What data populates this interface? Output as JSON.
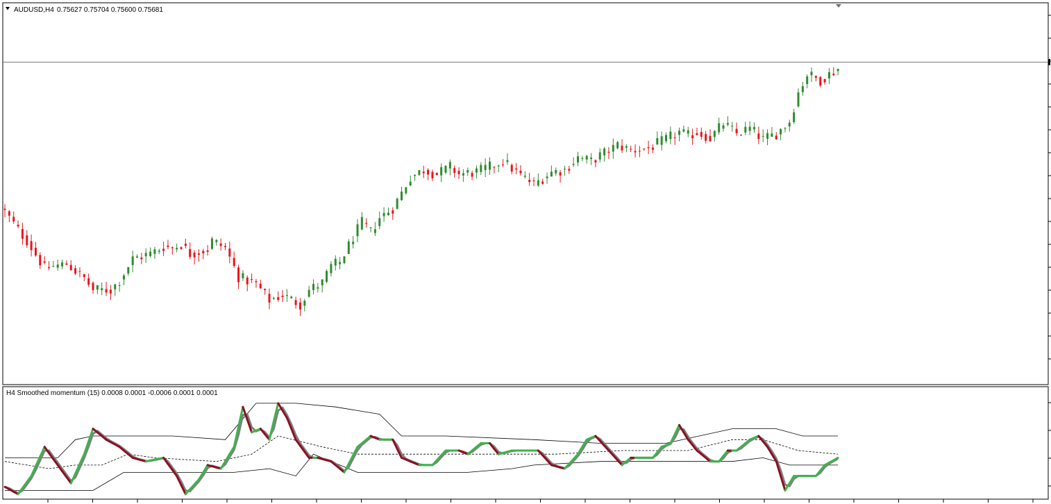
{
  "main_header": {
    "symbol_label": "AUDUSD,H4",
    "ohlc": "0.75627 0.75704 0.75600 0.75681"
  },
  "indicator_header": {
    "label": "H4 Smoothed momentum (15) 0.0008 0.0001 -0.0006 0.0001 0.0001"
  },
  "icons": {
    "header_menu": "triangle-down-icon",
    "shift_marker": "triangle-down-icon"
  },
  "colors": {
    "up_candle": "#2e8b2e",
    "down_candle": "#e8141a",
    "momentum_up": "#3cb44a",
    "momentum_down": "#8b1020",
    "momentum_raw": "#808080",
    "band": "#000000"
  },
  "chart_data": [
    {
      "type": "candlestick",
      "symbol": "AUDUSD",
      "timeframe": "H4",
      "last_price": 0.75681,
      "price_range": [
        0.7135,
        0.7655
      ],
      "count": 190,
      "close_path": [
        [
          0,
          0.737
        ],
        [
          3,
          0.7345
        ],
        [
          5,
          0.733
        ],
        [
          9,
          0.7292
        ],
        [
          14,
          0.7298
        ],
        [
          18,
          0.7278
        ],
        [
          20,
          0.7262
        ],
        [
          24,
          0.7262
        ],
        [
          26,
          0.7275
        ],
        [
          29,
          0.7305
        ],
        [
          33,
          0.7312
        ],
        [
          36,
          0.7322
        ],
        [
          38,
          0.732
        ],
        [
          40,
          0.7325
        ],
        [
          42,
          0.7312
        ],
        [
          46,
          0.7318
        ],
        [
          47,
          0.733
        ],
        [
          50,
          0.732
        ],
        [
          53,
          0.728
        ],
        [
          57,
          0.727
        ],
        [
          60,
          0.7248
        ],
        [
          63,
          0.7255
        ],
        [
          67,
          0.7242
        ],
        [
          69,
          0.7262
        ],
        [
          72,
          0.7272
        ],
        [
          74,
          0.7295
        ],
        [
          76,
          0.73
        ],
        [
          79,
          0.7335
        ],
        [
          81,
          0.7355
        ],
        [
          83,
          0.7342
        ],
        [
          85,
          0.7362
        ],
        [
          88,
          0.7375
        ],
        [
          92,
          0.7418
        ],
        [
          95,
          0.7428
        ],
        [
          98,
          0.7422
        ],
        [
          101,
          0.7432
        ],
        [
          103,
          0.7422
        ],
        [
          107,
          0.7425
        ],
        [
          110,
          0.7432
        ],
        [
          113,
          0.744
        ],
        [
          117,
          0.742
        ],
        [
          120,
          0.7408
        ],
        [
          124,
          0.7425
        ],
        [
          127,
          0.7428
        ],
        [
          130,
          0.7445
        ],
        [
          133,
          0.744
        ],
        [
          137,
          0.7455
        ],
        [
          139,
          0.7462
        ],
        [
          142,
          0.7455
        ],
        [
          146,
          0.7458
        ],
        [
          150,
          0.747
        ],
        [
          153,
          0.748
        ],
        [
          155,
          0.7475
        ],
        [
          157,
          0.748
        ],
        [
          160,
          0.7472
        ],
        [
          163,
          0.7492
        ],
        [
          166,
          0.7478
        ],
        [
          169,
          0.7485
        ],
        [
          172,
          0.747
        ],
        [
          175,
          0.7478
        ],
        [
          178,
          0.7495
        ],
        [
          180,
          0.7535
        ],
        [
          182,
          0.756
        ],
        [
          185,
          0.7552
        ],
        [
          189,
          0.7568
        ]
      ]
    },
    {
      "type": "line",
      "title": "H4 Smoothed momentum (15)",
      "values_shown": [
        0.0008,
        0.0001,
        -0.0006,
        0.0001,
        0.0001
      ],
      "value_range": [
        -0.0012,
        0.0018
      ],
      "series": [
        {
          "role": "momentum",
          "points": [
            [
              0,
              -0.0009
            ],
            [
              3,
              -0.0011
            ],
            [
              6,
              -0.0006
            ],
            [
              9,
              0.0002
            ],
            [
              12,
              -0.0003
            ],
            [
              15,
              -0.0008
            ],
            [
              18,
              0.0
            ],
            [
              20,
              0.0007
            ],
            [
              23,
              0.0004
            ],
            [
              26,
              0.0002
            ],
            [
              29,
              -0.0001
            ],
            [
              32,
              -0.0002
            ],
            [
              36,
              -0.0001
            ],
            [
              39,
              -0.0006
            ],
            [
              41,
              -0.0011
            ],
            [
              44,
              -0.0007
            ],
            [
              46,
              -0.0003
            ],
            [
              49,
              -0.0004
            ],
            [
              52,
              0.0002
            ],
            [
              54,
              0.0013
            ],
            [
              56,
              0.0006
            ],
            [
              58,
              0.0007
            ],
            [
              60,
              0.0004
            ],
            [
              62,
              0.0014
            ],
            [
              64,
              0.001
            ],
            [
              66,
              0.0004
            ],
            [
              69,
              -0.0001
            ],
            [
              71,
              -0.0001
            ],
            [
              74,
              -0.0002
            ],
            [
              77,
              -0.0005
            ],
            [
              80,
              0.0002
            ],
            [
              83,
              0.0005
            ],
            [
              85,
              0.0004
            ],
            [
              88,
              0.0004
            ],
            [
              90,
              -0.0001
            ],
            [
              94,
              -0.0003
            ],
            [
              97,
              -0.0003
            ],
            [
              100,
              0.0001
            ],
            [
              103,
              0.0001
            ],
            [
              105,
              0.0
            ],
            [
              108,
              0.0003
            ],
            [
              110,
              0.0003
            ],
            [
              112,
              0.0
            ],
            [
              115,
              0.0001
            ],
            [
              118,
              0.0001
            ],
            [
              121,
              0.0001
            ],
            [
              124,
              -0.0003
            ],
            [
              127,
              -0.0004
            ],
            [
              130,
              0.0
            ],
            [
              132,
              0.0004
            ],
            [
              134,
              0.0005
            ],
            [
              137,
              0.0001
            ],
            [
              140,
              -0.0003
            ],
            [
              142,
              -0.0001
            ],
            [
              145,
              -0.0001
            ],
            [
              147,
              -0.0001
            ],
            [
              149,
              0.0002
            ],
            [
              151,
              0.0003
            ],
            [
              153,
              0.0008
            ],
            [
              155,
              0.0004
            ],
            [
              157,
              0.0001
            ],
            [
              160,
              -0.0002
            ],
            [
              162,
              -0.0002
            ],
            [
              164,
              0.0001
            ],
            [
              166,
              0.0001
            ],
            [
              169,
              0.0004
            ],
            [
              171,
              0.0005
            ],
            [
              173,
              0.0002
            ],
            [
              175,
              -0.0002
            ],
            [
              177,
              -0.001
            ],
            [
              179,
              -0.0006
            ],
            [
              182,
              -0.0006
            ],
            [
              184,
              -0.0006
            ],
            [
              186,
              -0.0003
            ],
            [
              189,
              -0.0001
            ]
          ]
        },
        {
          "role": "upper-band",
          "points": [
            [
              0,
              -0.0001
            ],
            [
              8,
              -0.0001
            ],
            [
              12,
              -0.0001
            ],
            [
              16,
              0.0004
            ],
            [
              20,
              0.0005
            ],
            [
              30,
              0.0005
            ],
            [
              38,
              0.0005
            ],
            [
              50,
              0.0004
            ],
            [
              57,
              0.0014
            ],
            [
              66,
              0.0014
            ],
            [
              75,
              0.0013
            ],
            [
              85,
              0.0011
            ],
            [
              90,
              0.0005
            ],
            [
              100,
              0.0005
            ],
            [
              120,
              0.0004
            ],
            [
              135,
              0.0003
            ],
            [
              150,
              0.0003
            ],
            [
              165,
              0.0007
            ],
            [
              175,
              0.0007
            ],
            [
              181,
              0.0005
            ],
            [
              189,
              0.0005
            ]
          ]
        },
        {
          "role": "middle-band",
          "points": [
            [
              0,
              -0.0002
            ],
            [
              10,
              -0.0004
            ],
            [
              16,
              -0.0003
            ],
            [
              22,
              -0.0003
            ],
            [
              28,
              0.0
            ],
            [
              34,
              -0.0001
            ],
            [
              48,
              -0.0002
            ],
            [
              56,
              0.0
            ],
            [
              62,
              0.0005
            ],
            [
              72,
              0.0002
            ],
            [
              80,
              0.0
            ],
            [
              95,
              0.0
            ],
            [
              110,
              0.0
            ],
            [
              125,
              0.0
            ],
            [
              140,
              0.0001
            ],
            [
              155,
              0.0001
            ],
            [
              165,
              0.0004
            ],
            [
              172,
              0.0004
            ],
            [
              180,
              0.0001
            ],
            [
              189,
              0.0
            ]
          ]
        },
        {
          "role": "lower-band",
          "points": [
            [
              0,
              -0.001
            ],
            [
              10,
              -0.001
            ],
            [
              20,
              -0.001
            ],
            [
              27,
              -0.0005
            ],
            [
              37,
              -0.0005
            ],
            [
              45,
              -0.0005
            ],
            [
              52,
              -0.0005
            ],
            [
              60,
              -0.0004
            ],
            [
              66,
              -0.0006
            ],
            [
              70,
              0.0
            ],
            [
              80,
              -0.0005
            ],
            [
              100,
              -0.0005
            ],
            [
              105,
              -0.0005
            ],
            [
              115,
              -0.0004
            ],
            [
              120,
              -0.0003
            ],
            [
              135,
              -0.0002
            ],
            [
              155,
              -0.0002
            ],
            [
              165,
              -0.0002
            ],
            [
              172,
              -0.0001
            ],
            [
              178,
              -0.0003
            ],
            [
              189,
              -0.0003
            ]
          ]
        }
      ]
    }
  ]
}
